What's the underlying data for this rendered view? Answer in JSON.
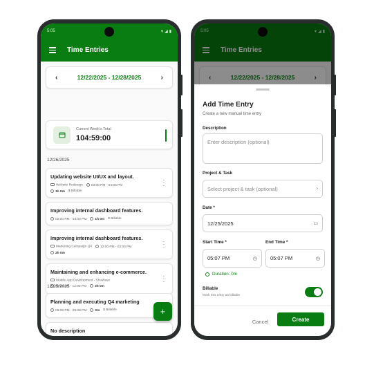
{
  "status": {
    "time": "5:05"
  },
  "app": {
    "title": "Time Entries"
  },
  "week": {
    "range": "12/22/2025 - 12/28/2025"
  },
  "summary": {
    "label": "Current Week's Total",
    "value": "104:59:00"
  },
  "days": [
    {
      "date": "12/26/2025",
      "entries": [
        {
          "title": "Updating website UI/UX and layout.",
          "project": "Website Redesign",
          "time": "03:00 PM - 04:00 PM",
          "duration": "1h 0m",
          "billable": "$ Billable"
        },
        {
          "title": "Improving internal dashboard features.",
          "time": "02:00 PM - 03:00 PM",
          "duration": "1h 0m",
          "billable": "$ Billable"
        },
        {
          "title": "Improving internal dashboard features.",
          "project": "Marketing Campaign Q4",
          "time": "12:00 PM - 02:00 PM",
          "duration": "2h 0m"
        },
        {
          "title": "Maintaining and enhancing e-commerce.",
          "project": "Mobile App Development - ShuWave",
          "time": "09:00 AM - 12:00 PM",
          "duration": "3h 0m"
        }
      ]
    },
    {
      "date": "12/25/2025",
      "entries": [
        {
          "title": "Planning and executing Q4 marketing",
          "time": "05:08 PM - 05:08 PM",
          "duration": "0m",
          "billable": "$ Billable"
        },
        {
          "title": "No description"
        }
      ]
    }
  ],
  "form": {
    "title": "Add Time Entry",
    "subtitle": "Create a new manual time entry",
    "description_label": "Description",
    "description_placeholder": "Enter description (optional)",
    "project_label": "Project & Task",
    "project_placeholder": "Select project & task (optional)",
    "date_label": "Date *",
    "date_value": "12/25/2025",
    "start_label": "Start Time *",
    "start_value": "05:07 PM",
    "end_label": "End Time *",
    "end_value": "05:07 PM",
    "duration": "Duration: 0m",
    "billable_label": "Billable",
    "billable_note": "Mark this entry as billable",
    "billable_on": true,
    "cancel": "Cancel",
    "create": "Create"
  },
  "colors": {
    "primary": "#0a7d12"
  }
}
